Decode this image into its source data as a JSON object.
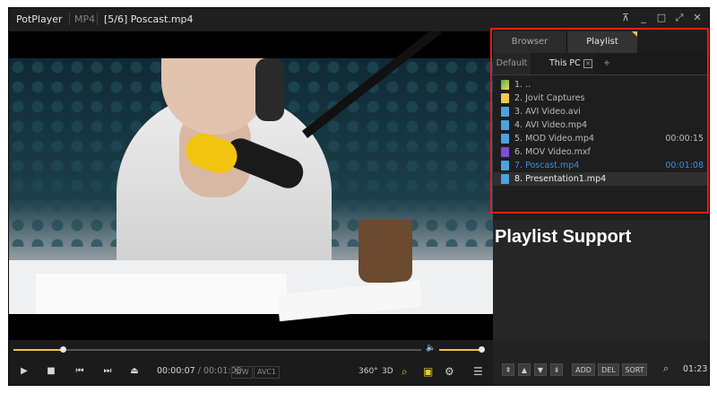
{
  "titlebar": {
    "app": "PotPlayer",
    "chevron": "⌄",
    "format": "MP4",
    "file": "[5/6] Poscast.mp4",
    "controls": [
      "⊼",
      "_",
      "□",
      "⤢",
      "✕"
    ]
  },
  "panel": {
    "tabs": {
      "browser": "Browser",
      "playlist": "Playlist"
    },
    "subtabs": {
      "default": "Default",
      "this_pc": "This PC",
      "close": "✕",
      "add": "+"
    },
    "items": [
      {
        "label": "1. ..",
        "duration": ""
      },
      {
        "label": "2. Jovit Captures",
        "duration": ""
      },
      {
        "label": "3. AVI Video.avi",
        "duration": ""
      },
      {
        "label": "4. AVI Video.mp4",
        "duration": ""
      },
      {
        "label": "5. MOD Video.mp4",
        "duration": "00:00:15"
      },
      {
        "label": "6. MOV Video.mxf",
        "duration": ""
      },
      {
        "label": "7. Poscast.mp4",
        "duration": "00:01:08"
      },
      {
        "label": "8. Presentation1.mp4",
        "duration": ""
      }
    ],
    "active_index": 6,
    "selected_index": 7
  },
  "annotation": {
    "label": "Playlist Support",
    "highlight_color": "#e0201b"
  },
  "controls": {
    "current_time": "00:00:07",
    "separator": "/",
    "total_time": "00:01:08",
    "tag_sw": "S/W",
    "tag_codec": "AVC1",
    "badge_360": "360°",
    "badge_3d": "3D",
    "seek_progress": 0.12,
    "volume_level": 1.0,
    "play": "▶",
    "stop": "■",
    "prev": "⏮",
    "next": "⏭",
    "eject": "⏏",
    "volume": "🔈",
    "search": "⌕",
    "subtitle": "▣",
    "settings": "⚙",
    "menu": "☰"
  },
  "playlist_bar": {
    "buttons": [
      "⇞",
      "▲",
      "▼",
      "⇟",
      "ADD",
      "DEL",
      "SORT"
    ],
    "search": "⌕",
    "time": "01:23"
  },
  "colors": {
    "accent": "#e8c640",
    "active": "#3a8ee6"
  }
}
